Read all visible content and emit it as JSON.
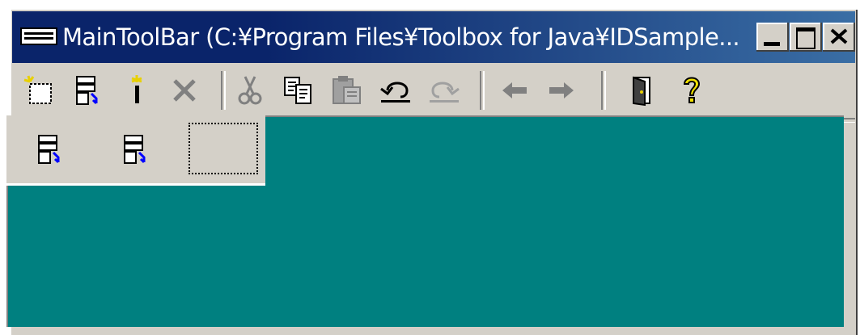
{
  "window": {
    "title": "MainToolBar (C:¥Program Files¥Toolbox for Java¥IDSample...",
    "caption_buttons": [
      "minimize",
      "maximize",
      "close"
    ]
  },
  "toolbar": {
    "buttons": [
      {
        "name": "new-icon",
        "enabled": true
      },
      {
        "name": "properties-icon",
        "enabled": true
      },
      {
        "name": "wand-icon",
        "enabled": true
      },
      {
        "name": "delete-icon",
        "enabled": false
      },
      {
        "name": "cut-icon",
        "enabled": false
      },
      {
        "name": "copy-icon",
        "enabled": true
      },
      {
        "name": "paste-icon",
        "enabled": false
      },
      {
        "name": "undo-icon",
        "enabled": true
      },
      {
        "name": "redo-icon",
        "enabled": false
      },
      {
        "name": "back-icon",
        "enabled": false
      },
      {
        "name": "forward-icon",
        "enabled": false
      },
      {
        "name": "exit-door-icon",
        "enabled": true
      },
      {
        "name": "help-icon",
        "enabled": true
      }
    ]
  },
  "palette": {
    "items": [
      "properties-icon",
      "properties-icon",
      "empty-slot"
    ]
  },
  "colors": {
    "title_bar": "#0a246a",
    "client_area": "#008080",
    "face": "#d4d0c8"
  }
}
